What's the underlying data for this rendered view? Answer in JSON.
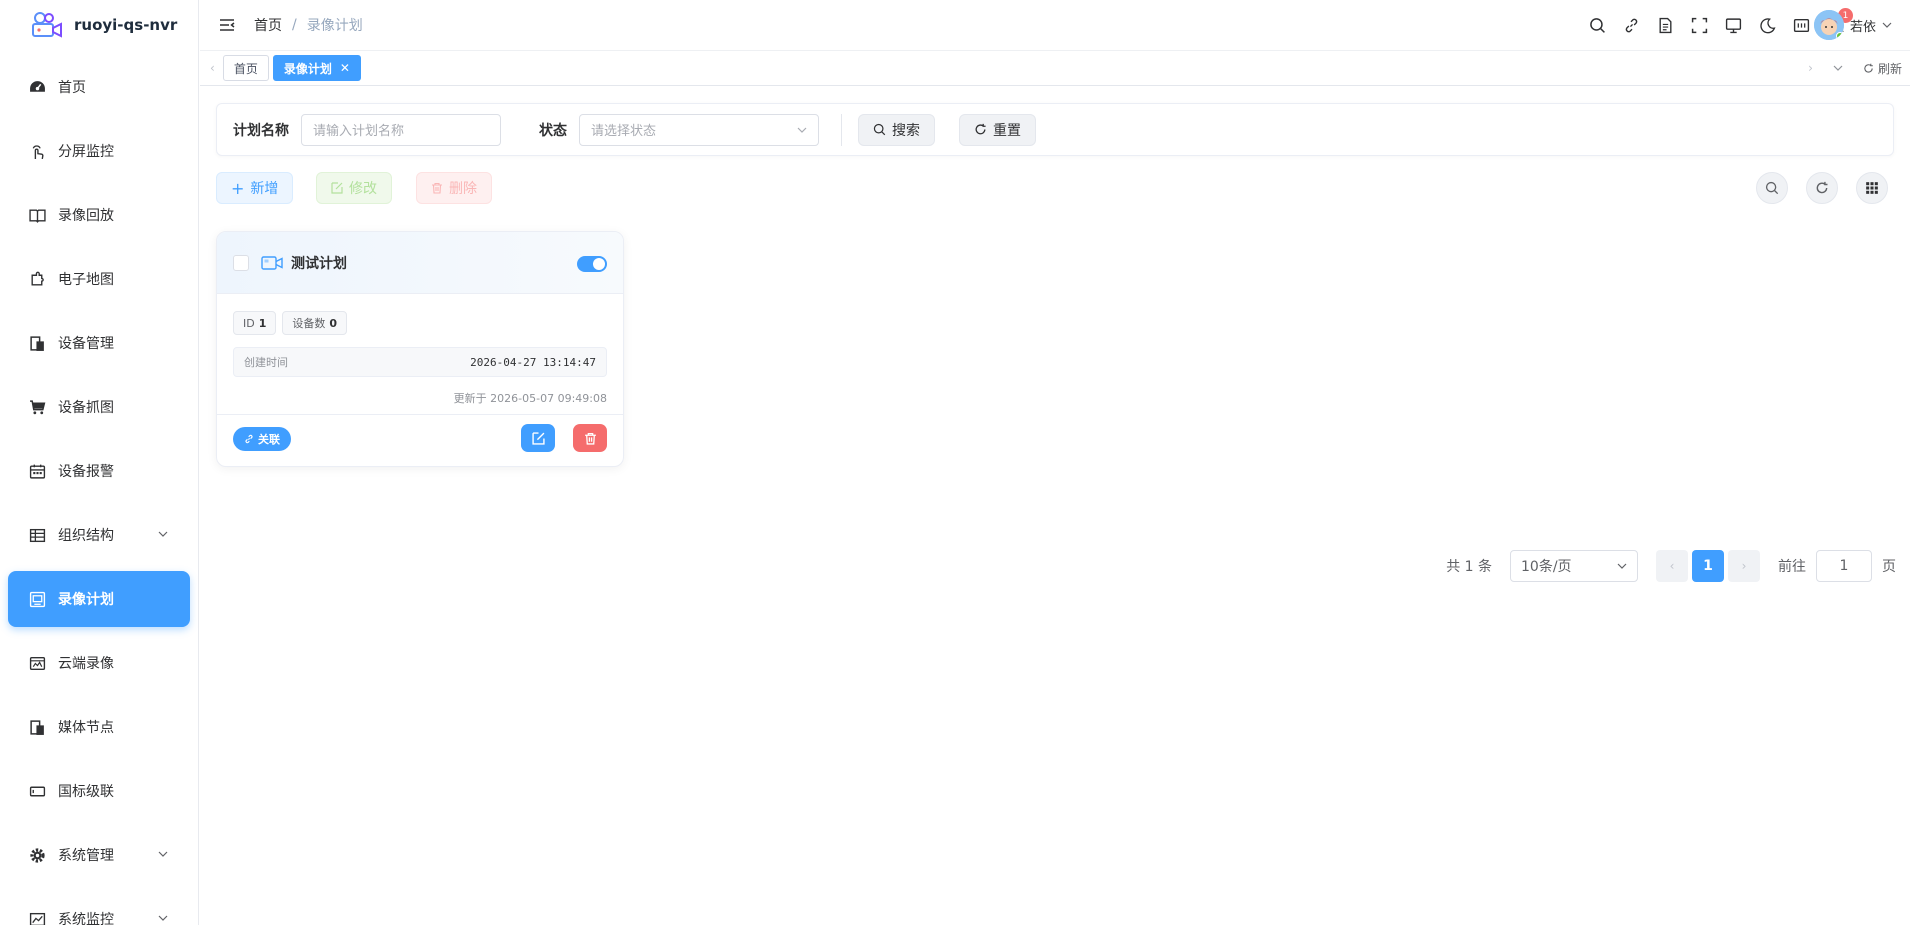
{
  "app": {
    "name": "ruoyi-qs-nvr"
  },
  "colors": {
    "primary": "#409eff",
    "danger": "#f56c6c",
    "success": "#67c23a"
  },
  "sidebar": {
    "items": [
      {
        "label": "首页",
        "icon": "dashboard-icon"
      },
      {
        "label": "分屏监控",
        "icon": "monitor-touch-icon"
      },
      {
        "label": "录像回放",
        "icon": "book-icon"
      },
      {
        "label": "电子地图",
        "icon": "map-icon"
      },
      {
        "label": "设备管理",
        "icon": "device-icon"
      },
      {
        "label": "设备抓图",
        "icon": "cart-icon"
      },
      {
        "label": "设备报警",
        "icon": "calendar-icon"
      },
      {
        "label": "组织结构",
        "icon": "table-icon"
      },
      {
        "label": "录像计划",
        "icon": "screen-icon"
      },
      {
        "label": "云端录像",
        "icon": "cloud-record-icon"
      },
      {
        "label": "媒体节点",
        "icon": "media-icon"
      },
      {
        "label": "国标级联",
        "icon": "cascade-icon"
      },
      {
        "label": "系统管理",
        "icon": "gear-icon"
      },
      {
        "label": "系统监控",
        "icon": "chart-icon"
      }
    ]
  },
  "header": {
    "breadcrumb": [
      "首页",
      "录像计划"
    ],
    "breadcrumb_sep": "/",
    "notification_count": "1",
    "user_name": "若依"
  },
  "tags": {
    "items": [
      "首页",
      "录像计划"
    ],
    "refresh_label": "刷新"
  },
  "search": {
    "name_label": "计划名称",
    "name_placeholder": "请输入计划名称",
    "status_label": "状态",
    "status_placeholder": "请选择状态",
    "search_label": "搜索",
    "reset_label": "重置"
  },
  "toolbar": {
    "add_label": "新增",
    "edit_label": "修改",
    "delete_label": "删除"
  },
  "card": {
    "title": "测试计划",
    "enabled": true,
    "id_label": "ID",
    "id_value": "1",
    "device_count_label": "设备数",
    "device_count_value": "0",
    "created_label": "创建时间",
    "created_value": "2026-04-27 13:14:47",
    "updated_text": "更新于 2026-05-07 09:49:08",
    "link_label": "关联"
  },
  "pagination": {
    "total_text": "共 1 条",
    "page_size": "10条/页",
    "current_page": "1",
    "goto_label": "前往",
    "goto_value": "1",
    "page_suffix": "页"
  }
}
